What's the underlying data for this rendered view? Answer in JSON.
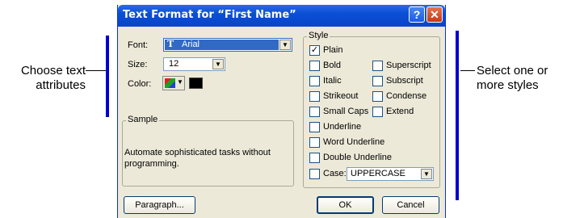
{
  "callouts": {
    "left": {
      "line1": "Choose text",
      "line2": "attributes"
    },
    "right": {
      "line1": "Select one or",
      "line2": "more styles"
    }
  },
  "dialog": {
    "title": "Text Format for “First Name”",
    "help_label": "?",
    "close_label": "✕"
  },
  "font": {
    "label": "Font:",
    "value": "Arial",
    "icon": "truetype-font-icon"
  },
  "size": {
    "label": "Size:",
    "value": "12"
  },
  "color": {
    "label": "Color:",
    "swatch": "#000000"
  },
  "sample": {
    "title": "Sample",
    "text": "Automate sophisticated tasks without programming."
  },
  "style": {
    "title": "Style",
    "options": [
      {
        "label": "Plain",
        "checked": true
      },
      {
        "label": "Bold",
        "checked": false
      },
      {
        "label": "Italic",
        "checked": false
      },
      {
        "label": "Strikeout",
        "checked": false
      },
      {
        "label": "Small Caps",
        "checked": false
      },
      {
        "label": "Underline",
        "checked": false
      },
      {
        "label": "Word Underline",
        "checked": false
      },
      {
        "label": "Double Underline",
        "checked": false
      },
      {
        "label": "Superscript",
        "checked": false
      },
      {
        "label": "Subscript",
        "checked": false
      },
      {
        "label": "Condense",
        "checked": false
      },
      {
        "label": "Extend",
        "checked": false
      }
    ],
    "case": {
      "label": "Case:",
      "value": "UPPERCASE",
      "checked": false
    }
  },
  "buttons": {
    "paragraph": "Paragraph...",
    "ok": "OK",
    "cancel": "Cancel"
  },
  "colors": {
    "accent_bar": "#0000cc",
    "title_bar": "#0a4fd6",
    "dialog_bg": "#ece9d8"
  }
}
